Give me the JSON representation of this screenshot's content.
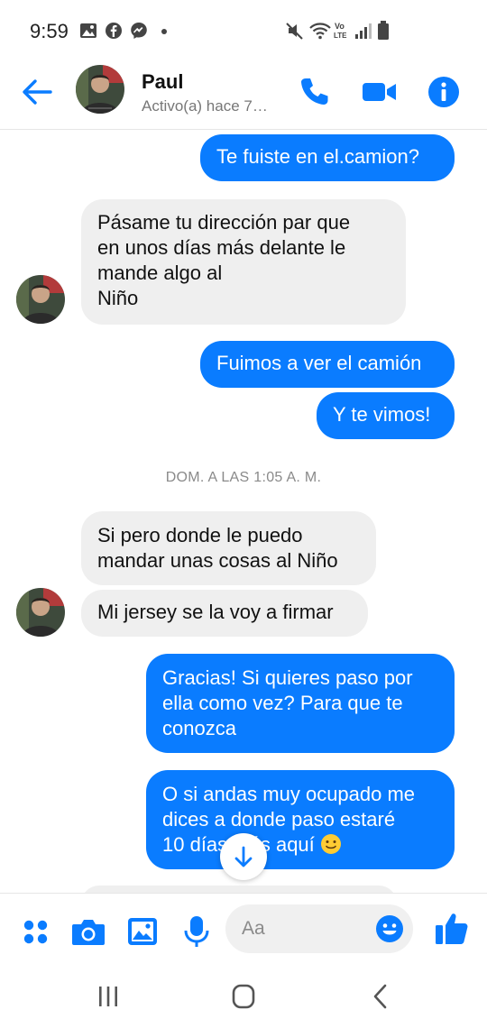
{
  "status_bar": {
    "time": "9:59",
    "left_icons": [
      "gallery-icon",
      "facebook-icon",
      "messenger-icon",
      "dot-icon"
    ],
    "right_icons": [
      "mute-icon",
      "wifi-icon",
      "volte-icon",
      "signal-icon",
      "battery-icon"
    ]
  },
  "header": {
    "name": "Paul",
    "status": "Activo(a) hace 7…",
    "icons": [
      "back-arrow-icon",
      "phone-icon",
      "video-icon",
      "info-icon"
    ]
  },
  "messages": [
    {
      "dir": "out",
      "text": "Te fuiste en el.camion?"
    },
    {
      "dir": "in",
      "text": "Pásame tu dirección par que en unos días más delante le mande algo al Niño"
    },
    {
      "dir": "out",
      "text": "Fuimos a ver el camión"
    },
    {
      "dir": "out",
      "text": "Y te vimos!"
    },
    {
      "dir": "in",
      "text": "Si pero donde le puedo mandar unas cosas al Niño"
    },
    {
      "dir": "in",
      "text": "Mi jersey se la voy a firmar"
    },
    {
      "dir": "out",
      "text": "Gracias! Si quieres paso por ella como vez? Para que te conozca"
    },
    {
      "dir": "out",
      "text": "O si andas muy ocupado me dices a donde paso estaré 10 días más aquí 🙂"
    }
  ],
  "message_lines": {
    "m1": [
      "Pásame tu dirección par que",
      "en unos días más delante le",
      "mande algo al",
      "Niño"
    ],
    "m4": [
      "Si pero donde le puedo",
      "mandar unas cosas al Niño"
    ],
    "m6": [
      "Gracias! Si quieres paso por",
      "ella como vez? Para que te",
      "conozca"
    ],
    "m7": [
      "O si andas muy ocupado me",
      "dices a donde paso estaré",
      "10 días más aquí"
    ]
  },
  "timestamp": "DOM. A LAS 1:05 A. M.",
  "composer": {
    "placeholder": "Aa",
    "icons": [
      "apps-icon",
      "camera-icon",
      "image-icon",
      "mic-icon",
      "emoji-icon",
      "thumbs-up-icon"
    ]
  },
  "navbar": {
    "icons": [
      "recent-apps-icon",
      "home-icon",
      "back-icon"
    ]
  },
  "colors": {
    "accent": "#0a7cff",
    "incoming_bubble": "#efefef"
  }
}
